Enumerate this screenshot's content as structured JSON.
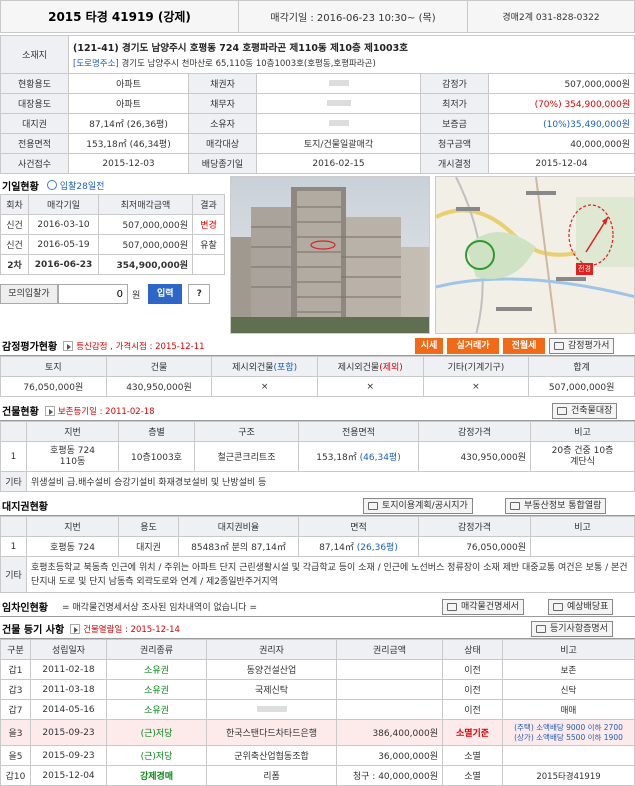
{
  "header": {
    "case": "2015 타경 41919 (강제)",
    "auction_date": "매각기일 : 2016-06-23 10:30~ (목)",
    "court": "경매2계 031-828-0322"
  },
  "info": {
    "location_label": "소재지",
    "address": "(121-41) 경기도 남양주시 호평동 724 호평파라곤 제110동 제10층 제1003호",
    "road_tag": "[도로명주소]",
    "road_address": "경기도 남양주시 천마산로 65,110동 10층1003호(호평동,호평파라곤)",
    "rows": [
      [
        "현황용도",
        "아파트",
        "채권자",
        "",
        "감정가",
        "507,000,000원"
      ],
      [
        "대장용도",
        "아파트",
        "채무자",
        "",
        "최저가",
        "(70%) 354,900,000원"
      ],
      [
        "대지권",
        "87,14㎡ (26,36평)",
        "소유자",
        "",
        "보증금",
        "(10%)35,490,000원"
      ],
      [
        "전용면적",
        "153,18㎡ (46,34평)",
        "매각대상",
        "토지/건물일괄매각",
        "청구금액",
        "40,000,000원"
      ],
      [
        "사건접수",
        "2015-12-03",
        "배당종기일",
        "2016-02-15",
        "개시결정",
        "2015-12-04"
      ]
    ]
  },
  "period": {
    "title": "기일현황",
    "badge": "입찰28일전",
    "headers": [
      "회차",
      "매각기일",
      "최저매각금액",
      "결과"
    ],
    "rows": [
      [
        "신건",
        "2016-03-10",
        "507,000,000원",
        "변경"
      ],
      [
        "신건",
        "2016-05-19",
        "507,000,000원",
        "유찰"
      ],
      [
        "2차",
        "2016-06-23",
        "354,900,000원",
        ""
      ]
    ],
    "sim_label": "모의입찰가",
    "sim_value": "0",
    "won": "원",
    "bid_btn": "입력",
    "help_btn": "?"
  },
  "photo_map": {
    "map_pin": "전경"
  },
  "appraisal": {
    "title": "감정평가현황",
    "sub": "등신감정 , 가격시점 : 2015-12-11",
    "btn_market": "시세",
    "btn_trade": "실거래가",
    "btn_lease": "전월세",
    "btn_doc": "감정평가서",
    "headers": [
      "토지",
      "건물",
      "제시외건물(포함)",
      "제시외건물(제외)",
      "기타(기계기구)",
      "합계"
    ],
    "h_incl": "(포함)",
    "h_excl": "(제외)",
    "row": [
      "76,050,000원",
      "430,950,000원",
      "×",
      "×",
      "×",
      "507,000,000원"
    ]
  },
  "building": {
    "title": "건물현황",
    "sub": "보존등기일 : 2011-02-18",
    "btn": "건축물대장",
    "headers": [
      "",
      "지번",
      "층별",
      "구조",
      "전용면적",
      "감정가격",
      "비고"
    ],
    "row": [
      "1",
      "호평동 724\n110동",
      "10층1003호",
      "철근콘크리트조",
      "153,18㎡ (46,34평)",
      "430,950,000원",
      "20층 건중 10층\n계단식"
    ],
    "other_label": "기타",
    "other": "위생설비 급.배수설비 승강기설비 화재경보설비 및 난방설비 등"
  },
  "land": {
    "title": "대지권현황",
    "btn1": "토지이용계획/공시지가",
    "btn2": "부동산정보 통합열람",
    "headers": [
      "",
      "지번",
      "용도",
      "대지권비율",
      "면적",
      "감정가격",
      "비고"
    ],
    "row": [
      "1",
      "호평동 724",
      "대지권",
      "85483㎡ 분의 87,14㎡",
      "87,14㎡ (26,36평)",
      "76,050,000원",
      ""
    ],
    "other_label": "기타",
    "other": "호평초등학교 북동측 인근에 위치 / 주위는 아파트 단지 근린생활시설 및 각급학교 등이 소재 / 인근에 노선버스 정류장이 소재 제반 대중교통 여건은 보통 / 본건 단지내 도로 및 단지 남동측 외곽도로와 연계 / 제2종일반주거지역"
  },
  "tenant": {
    "title": "임차인현황",
    "note": "= 매각물건명세서상 조사된 임차내역이 없습니다 =",
    "btn1": "매각물건명세서",
    "btn2": "예상배당표"
  },
  "registry": {
    "title": "건물 등기 사항",
    "sub": "건물열람일 : 2015-12-14",
    "btn": "등기사항증명서",
    "headers": [
      "구분",
      "성립일자",
      "권리종류",
      "권리자",
      "권리금액",
      "상태",
      "비고"
    ],
    "rows": [
      [
        "갑1",
        "2011-02-18",
        "소유권",
        "동양건설산업",
        "",
        "이전",
        "보존"
      ],
      [
        "갑3",
        "2011-03-18",
        "소유권",
        "국제신탁",
        "",
        "이전",
        "신탁"
      ],
      [
        "갑7",
        "2014-05-16",
        "소유권",
        "",
        "",
        "이전",
        "매매"
      ],
      [
        "을3",
        "2015-09-23",
        "(근)저당",
        "한국스탠다드차타드은행",
        "386,400,000원",
        "소멸기준",
        "(주택) 소액배당 9000 이하 2700\n(상가) 소액배당 5500 이하 1900"
      ],
      [
        "을5",
        "2015-09-23",
        "(근)저당",
        "군위축산업협동조합",
        "36,000,000원",
        "소멸",
        ""
      ],
      [
        "갑10",
        "2015-12-04",
        "강제경매",
        "리폼",
        "청구 : 40,000,000원",
        "소멸",
        "2015타경41919"
      ]
    ]
  },
  "colors": {
    "accent": "#f06a18",
    "red": "#d00000",
    "green": "#0a8a1a",
    "blue": "#1b5fc0"
  }
}
